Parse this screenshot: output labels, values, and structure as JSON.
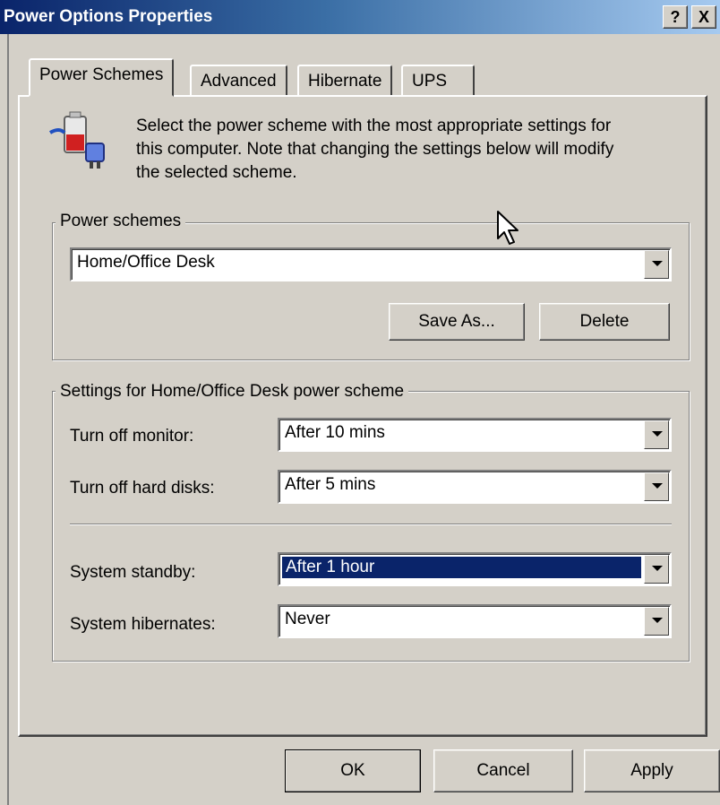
{
  "window": {
    "title": "Power Options Properties",
    "help_button": "?",
    "close_button": "X"
  },
  "tabs": [
    {
      "label": "Power Schemes",
      "active": true
    },
    {
      "label": "Advanced",
      "active": false
    },
    {
      "label": "Hibernate",
      "active": false
    },
    {
      "label": "UPS",
      "active": false
    }
  ],
  "intro": {
    "icon": "power-scheme-icon",
    "line1": "Select the power scheme with the most appropriate settings for",
    "line2": "this computer. Note that changing the settings below will modify",
    "line3": "the selected scheme."
  },
  "schemes_group": {
    "label": "Power schemes",
    "selected": "Home/Office Desk",
    "save_as": "Save As...",
    "delete": "Delete"
  },
  "settings_group": {
    "label": "Settings for Home/Office Desk power scheme",
    "monitor": {
      "label": "Turn off monitor:",
      "value": "After 10 mins"
    },
    "disks": {
      "label": "Turn off hard disks:",
      "value": "After 5 mins"
    },
    "standby": {
      "label": "System standby:",
      "value": "After 1 hour"
    },
    "hibernate": {
      "label": "System hibernates:",
      "value": "Never"
    }
  },
  "footer": {
    "ok": "OK",
    "cancel": "Cancel",
    "apply": "Apply"
  },
  "colors": {
    "face": "#d4d0c8",
    "title_active": "#0a246a",
    "selection": "#0a246a"
  }
}
